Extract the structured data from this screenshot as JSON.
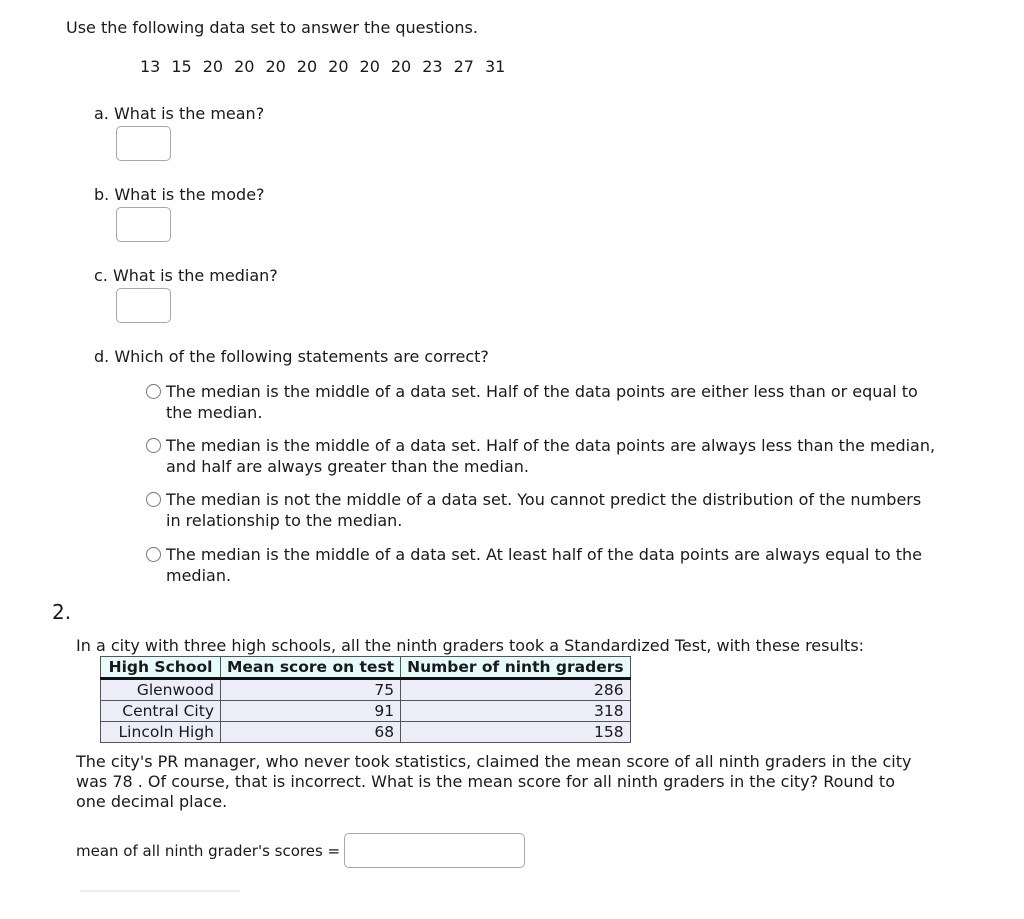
{
  "question1": {
    "intro": "Use the following data set to answer the questions.",
    "dataset": [
      "13",
      "15",
      "20",
      "20",
      "20",
      "20",
      "20",
      "20",
      "20",
      "23",
      "27",
      "31"
    ],
    "parts": [
      {
        "label": "a. What is the mean?",
        "answer": ""
      },
      {
        "label": "b. What is the mode?",
        "answer": ""
      },
      {
        "label": "c. What is the median?",
        "answer": ""
      }
    ],
    "part_d": {
      "label": "d. Which of the following statements are correct?",
      "options": [
        "The median is the middle of a data set. Half of the data points are either less than or equal to the median.",
        "The median is the middle of a data set. Half of the data points are always less than the median, and half are always greater than the median.",
        "The median is not the middle of a data set. You cannot predict the distribution of the numbers in relationship to the median.",
        "The median is the middle of a data set. At least half of the data points are always equal to the median."
      ]
    }
  },
  "question2": {
    "number": "2.",
    "intro": "In a city with three high schools, all the ninth graders took a Standardized Test, with these results:",
    "table": {
      "headers": [
        "High School",
        "Mean score on test",
        "Number of ninth graders"
      ],
      "rows": [
        [
          "Glenwood",
          "75",
          "286"
        ],
        [
          "Central City",
          "91",
          "318"
        ],
        [
          "Lincoln High",
          "68",
          "158"
        ]
      ]
    },
    "body": "The city's PR manager, who never took statistics, claimed the mean score of all ninth graders in the city was 78 . Of course, that is incorrect. What is the mean score for all ninth graders in the city? Round to one decimal place.",
    "answer_label": "mean of all ninth grader's scores =",
    "answer_value": ""
  },
  "colors": {
    "table_header_bg": "#e6fbfb",
    "table_cell_bg": "#ededf9",
    "input_border": "#a8a8a8"
  }
}
